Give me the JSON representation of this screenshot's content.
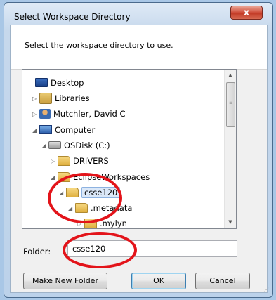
{
  "window": {
    "title": "Select Workspace Directory",
    "close_glyph": "x"
  },
  "header": {
    "instruction": "Select the workspace directory to use."
  },
  "tree": {
    "items": [
      {
        "label": "Desktop",
        "icon": "desktop-icon",
        "expander": ""
      },
      {
        "label": "Libraries",
        "icon": "libraries-icon",
        "expander": "▷"
      },
      {
        "label": "Mutchler, David C",
        "icon": "user-folder-icon",
        "expander": "▷"
      },
      {
        "label": "Computer",
        "icon": "computer-icon",
        "expander": "◢"
      },
      {
        "label": "OSDisk (C:)",
        "icon": "disk-icon",
        "expander": "◢"
      },
      {
        "label": "DRIVERS",
        "icon": "folder-icon",
        "expander": "▷"
      },
      {
        "label": "EclipseWorkspaces",
        "icon": "folder-icon",
        "expander": "◢"
      },
      {
        "label": "csse120",
        "icon": "folder-icon",
        "expander": "◢",
        "selected": true
      },
      {
        "label": ".metadata",
        "icon": "folder-icon",
        "expander": "◢"
      },
      {
        "label": ".mylyn",
        "icon": "folder-icon",
        "expander": "▷"
      }
    ]
  },
  "folder": {
    "label": "Folder:",
    "value": "csse120"
  },
  "buttons": {
    "make_new_folder": "Make New Folder",
    "ok": "OK",
    "cancel": "Cancel"
  },
  "colors": {
    "annotation": "#e3141a",
    "selection": "#dbe8f8"
  }
}
